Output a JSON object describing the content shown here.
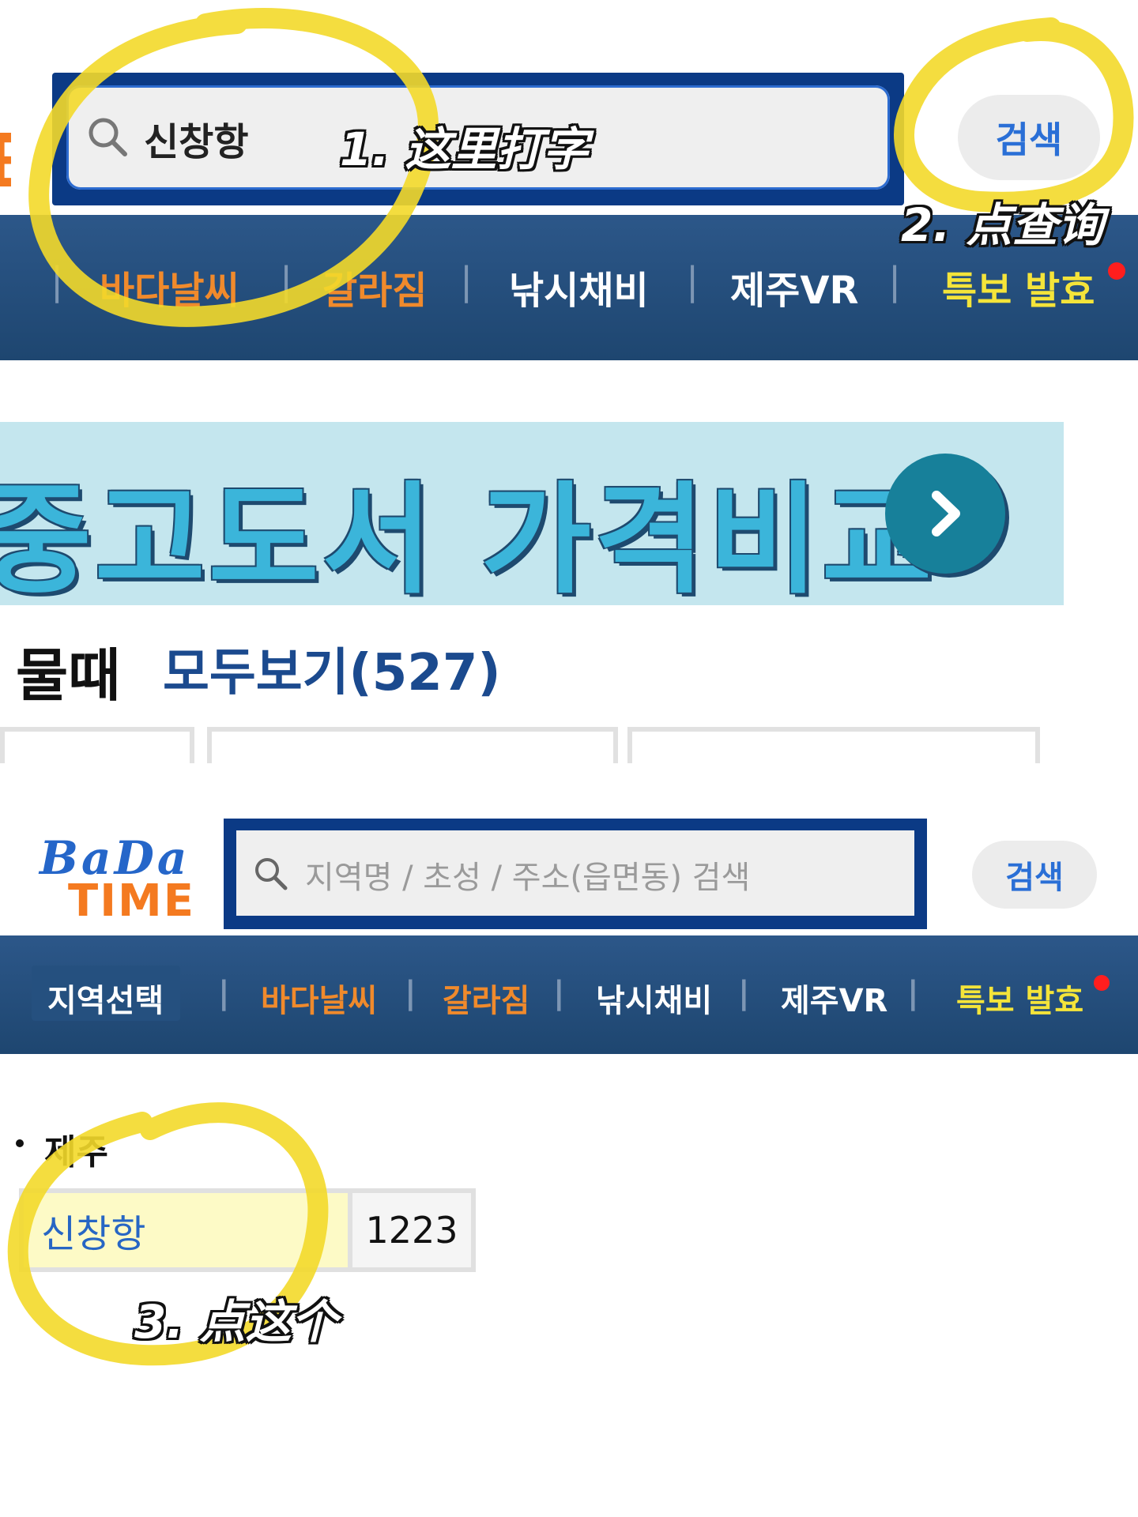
{
  "panel1": {
    "search": {
      "value": "신창항",
      "button_label": "검색"
    },
    "nav": {
      "items": [
        {
          "label": "바다날씨",
          "color": "#f08a2c"
        },
        {
          "label": "갈라짐",
          "color": "#f08a2c"
        },
        {
          "label": "낚시채비",
          "color": "#ffffff"
        },
        {
          "label": "제주VR",
          "color": "#ffffff"
        },
        {
          "label": "특보 발효",
          "color": "#f4e43a"
        }
      ],
      "separator": "|"
    },
    "banner": {
      "text": "중고도서 가격비교"
    },
    "tide": {
      "label": "물때",
      "link": "모두보기(527)"
    }
  },
  "panel2": {
    "logo": {
      "line1": "BaDa",
      "line2": "TIME"
    },
    "search": {
      "placeholder": "지역명 / 초성 / 주소(읍면동) 검색",
      "button_label": "검색"
    },
    "nav": {
      "region_select": "지역선택",
      "items": [
        {
          "label": "바다날씨",
          "color": "#f08a2c"
        },
        {
          "label": "갈라짐",
          "color": "#f08a2c"
        },
        {
          "label": "낚시채비",
          "color": "#ffffff"
        },
        {
          "label": "제주VR",
          "color": "#ffffff"
        },
        {
          "label": "특보 발효",
          "color": "#f4e43a"
        }
      ],
      "separator": "|"
    },
    "results": {
      "region": "제주",
      "items": [
        {
          "name": "신창항",
          "code": "1223"
        }
      ]
    }
  },
  "annotations": {
    "step1": "1. 这里打字",
    "step2": "2. 点查询",
    "step3": "3. 点这个",
    "highlight_color": "#f3d92a"
  },
  "colors": {
    "nav_bg": "#2c5789",
    "search_border": "#0b3a85",
    "accent_blue": "#2a6fd6",
    "alert_dot": "#ff1e1e"
  }
}
